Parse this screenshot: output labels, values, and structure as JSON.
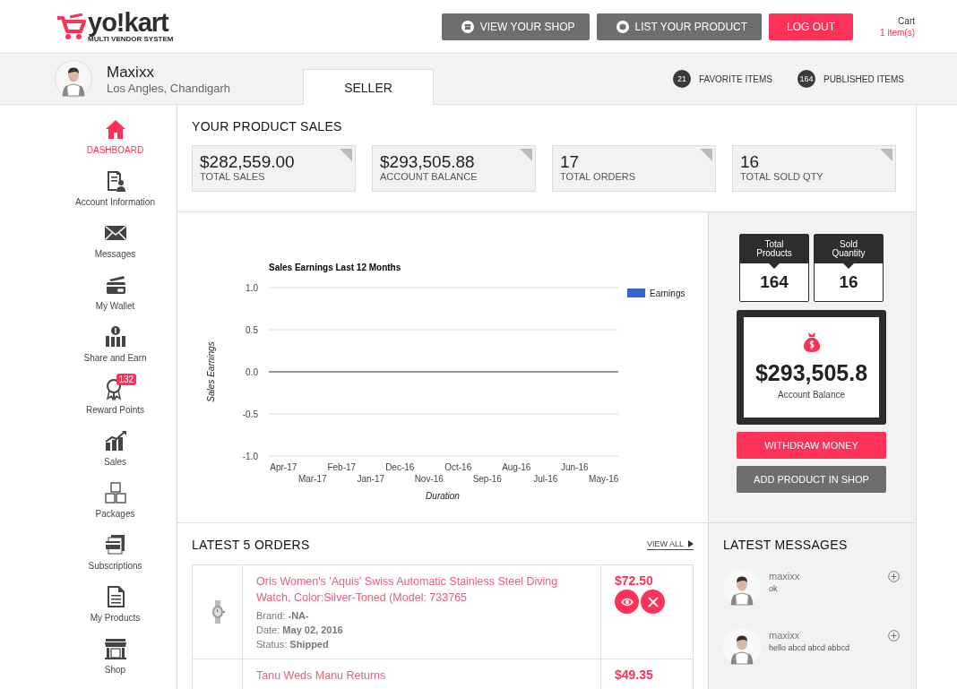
{
  "header": {
    "logo": {
      "name": "yo!kart",
      "tagline": "MULTI VENDOR SYSTEM"
    },
    "buttons": [
      {
        "label": "VIEW YOUR SHOP",
        "kind": "shop"
      },
      {
        "label": "LIST YOUR PRODUCT",
        "kind": "product"
      },
      {
        "label": "LOG OUT",
        "kind": "logout"
      }
    ],
    "cart": {
      "label": "Cart",
      "count": "1 item(s)"
    }
  },
  "profile": {
    "name": "Maxixx",
    "location": "Los Angles, Chandigarh",
    "tabs": [
      {
        "label": "SELLER",
        "selected": true
      }
    ],
    "counters": [
      {
        "count": "21",
        "label": "FAVORITE ITEMS"
      },
      {
        "count": "164",
        "label": "PUBLISHED ITEMS"
      }
    ]
  },
  "sidebar": {
    "items": [
      {
        "label": "DASHBOARD",
        "kind": "home",
        "selected": true
      },
      {
        "label": "Account Information",
        "kind": "account",
        "selected": false
      },
      {
        "label": "Messages",
        "kind": "mail",
        "selected": false
      },
      {
        "label": "My Wallet",
        "kind": "wallet",
        "selected": false
      },
      {
        "label": "Share and Earn",
        "kind": "share",
        "selected": false
      },
      {
        "label": "Reward Points",
        "kind": "award",
        "selected": false,
        "badge": "132"
      },
      {
        "label": "Sales",
        "kind": "sales",
        "selected": false
      },
      {
        "label": "Packages",
        "kind": "packages",
        "selected": false
      },
      {
        "label": "Subscriptions",
        "kind": "subscriptions",
        "selected": false
      },
      {
        "label": "My Products",
        "kind": "products",
        "selected": false
      },
      {
        "label": "Shop",
        "kind": "shop",
        "selected": false
      }
    ]
  },
  "sales": {
    "title": "YOUR PRODUCT SALES",
    "cards": [
      {
        "value": "$282,559.00",
        "label": "TOTAL SALES"
      },
      {
        "value": "$293,505.88",
        "label": "ACCOUNT BALANCE"
      },
      {
        "value": "17",
        "label": "TOTAL ORDERS"
      },
      {
        "value": "16",
        "label": "TOTAL SOLD QTY"
      }
    ]
  },
  "earnings": {
    "chart_data": {
      "type": "line",
      "title": "Sales Earnings Last 12 Months",
      "xlabel": "Duration",
      "ylabel": "Sales Earnings",
      "categories": [
        "Apr-17",
        "Mar-17",
        "Feb-17",
        "Jan-17",
        "Dec-16",
        "Nov-16",
        "Oct-16",
        "Sep-16",
        "Aug-16",
        "Jul-16",
        "Jun-16",
        "May-16"
      ],
      "series": [
        {
          "name": "Earnings",
          "color": "#3366cc",
          "values": [
            null,
            null,
            null,
            null,
            null,
            null,
            null,
            null,
            null,
            null,
            null,
            null
          ]
        }
      ],
      "ylim": [
        -1,
        1
      ],
      "yticks": [
        {
          "value": 1,
          "label": "1.0"
        },
        {
          "value": 0.5,
          "label": "0.5"
        },
        {
          "value": 0,
          "label": "0.0"
        },
        {
          "value": -0.5,
          "label": "-0.5"
        },
        {
          "value": -1,
          "label": "-1.0"
        }
      ]
    }
  },
  "summary": {
    "stats": [
      {
        "label": "Total Products",
        "value": "164"
      },
      {
        "label": "Sold Quantity",
        "value": "16"
      }
    ],
    "balance": {
      "amount": "$293,505.8",
      "label": "Account Balance"
    },
    "buttons": [
      {
        "label": "WITHDRAW MONEY",
        "kind": "primary"
      },
      {
        "label": "ADD PRODUCT IN SHOP",
        "kind": "secondary"
      }
    ]
  },
  "orders": {
    "title": "LATEST 5 ORDERS",
    "view_all": "VIEW ALL",
    "rows": [
      {
        "image": {
          "kind": "picture"
        },
        "title": "Oris Women's 'Aquis' Swiss Automatic Stainless Steel Diving Watch, Color:Silver-Toned (Model: 733765",
        "details": [
          "Brand: **-NA-**",
          "Date: **May 02, 2016**",
          "Status: **Shipped**"
        ],
        "price": "$72.50",
        "actions": true
      },
      {
        "title": "Tanu Weds Manu Returns",
        "price": "$49.35",
        "actions": false
      }
    ]
  },
  "messages": {
    "title": "LATEST MESSAGES",
    "items": [
      {
        "name": "maxixx",
        "text": "ok"
      },
      {
        "name": "maxixx",
        "text": "hello abcd abcd abbcd"
      }
    ]
  }
}
